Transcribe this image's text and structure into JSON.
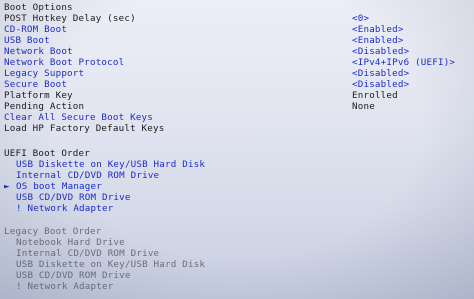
{
  "title": "Boot Options",
  "options": [
    {
      "label": "POST Hotkey Delay (sec)",
      "value": "<0>",
      "label_style": "plain"
    },
    {
      "label": "CD-ROM Boot",
      "value": "<Enabled>",
      "label_style": "sel"
    },
    {
      "label": "USB Boot",
      "value": "<Enabled>",
      "label_style": "sel"
    },
    {
      "label": "Network Boot",
      "value": "<Disabled>",
      "label_style": "sel"
    },
    {
      "label": "Network Boot Protocol",
      "value": "<IPv4+IPv6 (UEFI)>",
      "label_style": "sel"
    },
    {
      "label": "Legacy Support",
      "value": "<Disabled>",
      "label_style": "sel"
    },
    {
      "label": "Secure Boot",
      "value": "<Disabled>",
      "label_style": "sel"
    },
    {
      "label": "Platform Key",
      "value": "Enrolled",
      "label_style": "plain"
    },
    {
      "label": "Pending Action",
      "value": "None",
      "label_style": "plain"
    },
    {
      "label": "Clear All Secure Boot Keys",
      "value": "",
      "label_style": "sel"
    },
    {
      "label": "Load HP Factory Default Keys",
      "value": "",
      "label_style": "plain"
    }
  ],
  "uefi_boot_order": {
    "heading": "UEFI Boot Order",
    "items": [
      {
        "text": "USB Diskette on Key/USB Hard Disk",
        "selected": false
      },
      {
        "text": "Internal CD/DVD ROM Drive",
        "selected": false
      },
      {
        "text": "OS boot Manager",
        "selected": true
      },
      {
        "text": "USB CD/DVD ROM Drive",
        "selected": false
      },
      {
        "text": "! Network Adapter",
        "selected": false
      }
    ],
    "cursor_glyph": "►"
  },
  "legacy_boot_order": {
    "heading": "Legacy Boot Order",
    "items": [
      {
        "text": "Notebook Hard Drive"
      },
      {
        "text": "Internal CD/DVD ROM Drive"
      },
      {
        "text": "USB Diskette on Key/USB Hard Disk"
      },
      {
        "text": "USB CD/DVD ROM Drive"
      },
      {
        "text": "! Network Adapter"
      }
    ]
  },
  "colors": {
    "selectable": "#1a2bc8",
    "text": "#1a1a1a",
    "disabled": "#6b6f78",
    "background": "#e3e6f1"
  }
}
